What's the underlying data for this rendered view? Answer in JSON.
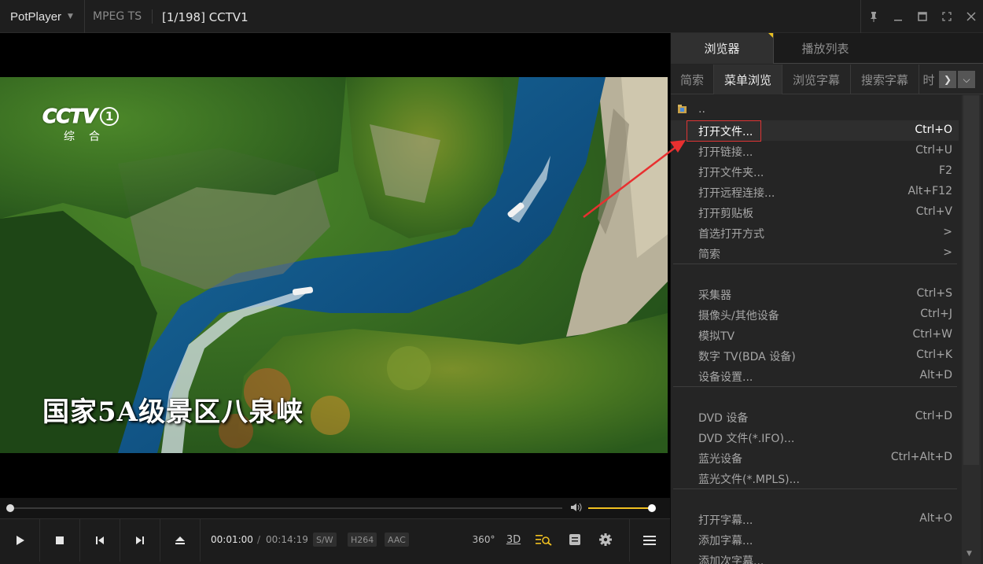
{
  "titlebar": {
    "app_name": "PotPlayer",
    "format": "MPEG TS",
    "file_title": "[1/198] CCTV1",
    "icons": [
      "pin-icon",
      "minimize-icon",
      "maximize-icon",
      "fullscreen-icon",
      "close-icon"
    ]
  },
  "video": {
    "channel_logo": "CCTV",
    "channel_number": "1",
    "channel_sub": "综合",
    "caption": "国家5A级景区八泉峡"
  },
  "seek": {
    "position_fraction": 0.0,
    "volume_fraction": 1.0
  },
  "controls": {
    "time_current": "00:01:00",
    "time_separator": "/",
    "time_total": "00:14:19",
    "badges": [
      "S/W",
      "H264",
      "AAC"
    ],
    "icons_left": [
      "play-icon",
      "stop-icon",
      "previous-icon",
      "next-icon",
      "eject-icon"
    ],
    "icons_right": [
      "360-icon",
      "3d-icon",
      "playlist-search-icon",
      "subtitle-icon",
      "settings-icon",
      "menu-icon"
    ],
    "icon_360_label": "360°",
    "icon_3d_label": "3D"
  },
  "panel": {
    "tabs": [
      {
        "label": "浏览器",
        "active": true
      },
      {
        "label": "播放列表",
        "active": false
      }
    ],
    "sub_tabs": [
      {
        "label": "简索",
        "active": false
      },
      {
        "label": "菜单浏览",
        "active": true
      },
      {
        "label": "浏览字幕",
        "active": false
      },
      {
        "label": "搜索字幕",
        "active": false
      },
      {
        "label": "时",
        "active": false
      }
    ],
    "parent_entry": "..",
    "menu": [
      {
        "label": "打开文件...",
        "key": "Ctrl+O",
        "highlight": true
      },
      {
        "label": "打开链接...",
        "key": "Ctrl+U"
      },
      {
        "label": "打开文件夹...",
        "key": "F2"
      },
      {
        "label": "打开远程连接...",
        "key": "Alt+F12"
      },
      {
        "label": "打开剪贴板",
        "key": "Ctrl+V"
      },
      {
        "label": "首选打开方式",
        "key": ">"
      },
      {
        "label": "简索",
        "key": ">"
      },
      {
        "label": "采集器",
        "key": "Ctrl+S"
      },
      {
        "label": "摄像头/其他设备",
        "key": "Ctrl+J"
      },
      {
        "label": "模拟TV",
        "key": "Ctrl+W"
      },
      {
        "label": "数字 TV(BDA 设备)",
        "key": "Ctrl+K"
      },
      {
        "label": "设备设置...",
        "key": "Alt+D"
      },
      {
        "label": "DVD 设备",
        "key": "Ctrl+D"
      },
      {
        "label": "DVD 文件(*.IFO)...",
        "key": ""
      },
      {
        "label": "蓝光设备",
        "key": "Ctrl+Alt+D"
      },
      {
        "label": "蓝光文件(*.MPLS)...",
        "key": ""
      },
      {
        "label": "打开字幕...",
        "key": "Alt+O"
      },
      {
        "label": "添加字幕...",
        "key": ""
      },
      {
        "label": "添加次字幕...",
        "key": ""
      }
    ]
  },
  "colors": {
    "accent": "#f0c020",
    "highlight_border": "#e03535",
    "annotation_arrow": "#e83030"
  }
}
